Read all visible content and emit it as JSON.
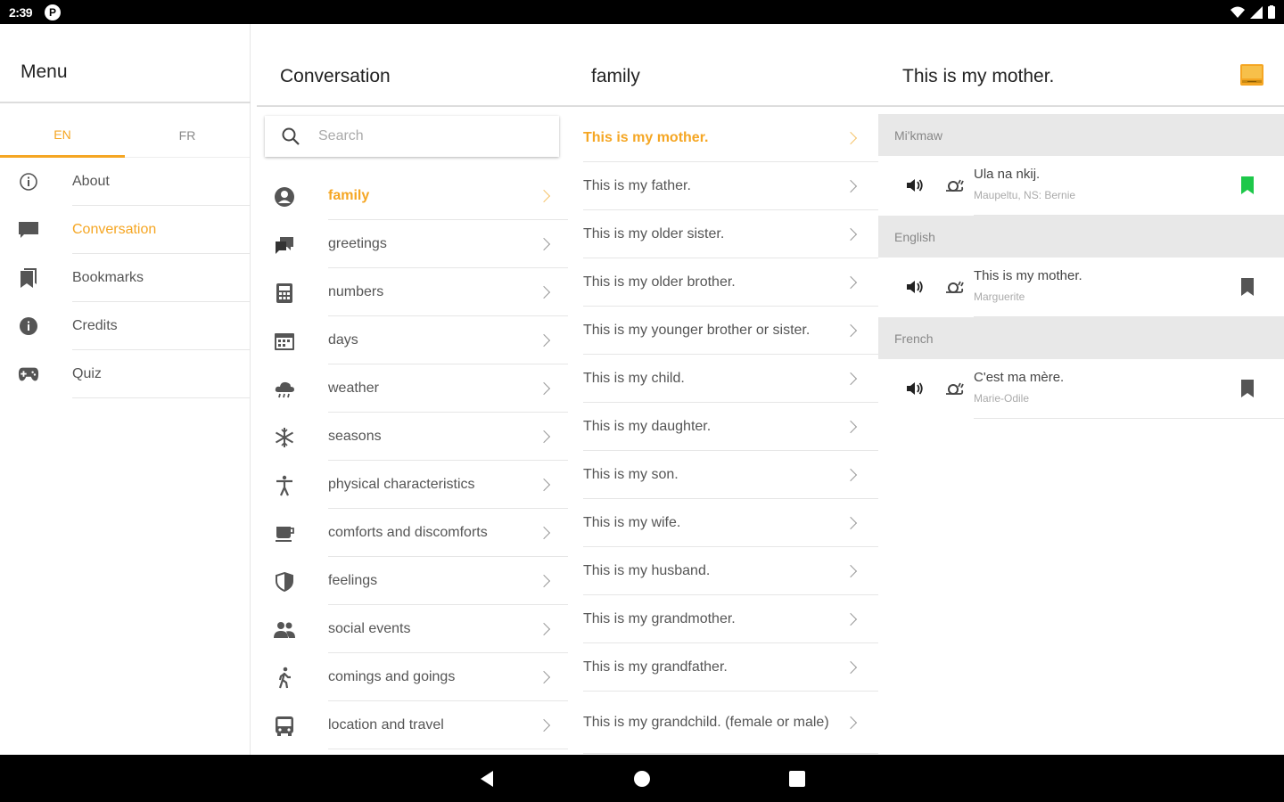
{
  "status_bar": {
    "time": "2:39",
    "p_label": "P"
  },
  "menu": {
    "title": "Menu",
    "lang_tabs": [
      {
        "label": "EN",
        "active": true
      },
      {
        "label": "FR",
        "active": false
      }
    ],
    "items": [
      {
        "label": "About",
        "icon": "info-outline-icon"
      },
      {
        "label": "Conversation",
        "icon": "chat-icon",
        "active": true
      },
      {
        "label": "Bookmarks",
        "icon": "bookmarks-icon"
      },
      {
        "label": "Credits",
        "icon": "info-icon"
      },
      {
        "label": "Quiz",
        "icon": "gamepad-icon"
      }
    ]
  },
  "conversation": {
    "title": "Conversation",
    "search_placeholder": "Search",
    "categories": [
      {
        "label": "family",
        "icon": "person-icon",
        "active": true
      },
      {
        "label": "greetings",
        "icon": "chat-bubbles-icon"
      },
      {
        "label": "numbers",
        "icon": "calculator-icon"
      },
      {
        "label": "days",
        "icon": "calendar-icon"
      },
      {
        "label": "weather",
        "icon": "cloud-rain-icon"
      },
      {
        "label": "seasons",
        "icon": "snowflake-icon"
      },
      {
        "label": "physical characteristics",
        "icon": "accessibility-icon"
      },
      {
        "label": "comforts and discomforts",
        "icon": "coffee-icon"
      },
      {
        "label": "feelings",
        "icon": "heart-shield-icon"
      },
      {
        "label": "social events",
        "icon": "people-icon"
      },
      {
        "label": "comings and goings",
        "icon": "walking-icon"
      },
      {
        "label": "location and travel",
        "icon": "bus-icon"
      }
    ]
  },
  "family": {
    "title": "family",
    "phrases": [
      "This is my mother.",
      "This is my father.",
      "This is my older sister.",
      "This is my older brother.",
      "This is my younger brother or sister.",
      "This is my child.",
      "This is my daughter.",
      "This is my son.",
      "This is my wife.",
      "This is my husband.",
      "This is my grandmother.",
      "This is my grandfather.",
      "This is my grandchild. (female or male)"
    ]
  },
  "phrase": {
    "title": "This is my mother.",
    "sections": [
      {
        "language": "Mi'kmaw",
        "text": "Ula na nkij.",
        "speaker": "Maupeltu, NS: Bernie",
        "bookmarked": true
      },
      {
        "language": "English",
        "text": "This is my mother.",
        "speaker": "Marguerite",
        "bookmarked": false
      },
      {
        "language": "French",
        "text": "C'est ma mère.",
        "speaker": "Marie-Odile",
        "bookmarked": false
      }
    ]
  },
  "colors": {
    "accent": "#f5a623",
    "bookmark_active": "#1ec84a",
    "icon_gray": "#555555"
  }
}
